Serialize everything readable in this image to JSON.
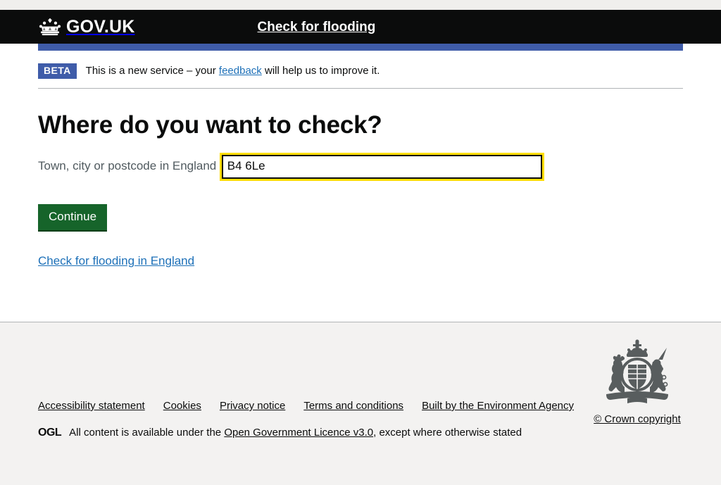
{
  "browser": {
    "top_strip": ""
  },
  "header": {
    "logo_text": "GOV.UK",
    "crown_icon": "crown-icon",
    "service_name": "Check for flooding"
  },
  "phase_banner": {
    "tag": "BETA",
    "text_before": "This is a new service – your ",
    "feedback_link": "feedback",
    "text_after": " will help us to improve it."
  },
  "main": {
    "heading": "Where do you want to check?",
    "hint": "Town, city or postcode in England",
    "input": {
      "value": "B4 6Le",
      "placeholder": ""
    },
    "continue_button": "Continue",
    "body_link": "Check for flooding in England"
  },
  "footer": {
    "links": [
      "Accessibility statement",
      "Cookies",
      "Privacy notice",
      "Terms and conditions",
      "Built by the Environment Agency"
    ],
    "ogl_logo": "OGL",
    "licence_before": "All content is available under the ",
    "licence_link": "Open Government Licence v3.0",
    "licence_after": ", except where otherwise stated",
    "crown_copyright": "© Crown copyright",
    "arms_icon": "royal-coat-of-arms-icon"
  },
  "colors": {
    "header_black": "#0b0c0c",
    "govuk_blue": "#3f5ca9",
    "link_blue": "#1d70b8",
    "button_green": "#16642a",
    "focus_yellow": "#ffdd00",
    "footer_grey": "#f3f2f1",
    "hint_grey": "#505a5f",
    "border_grey": "#b1b4b6"
  }
}
